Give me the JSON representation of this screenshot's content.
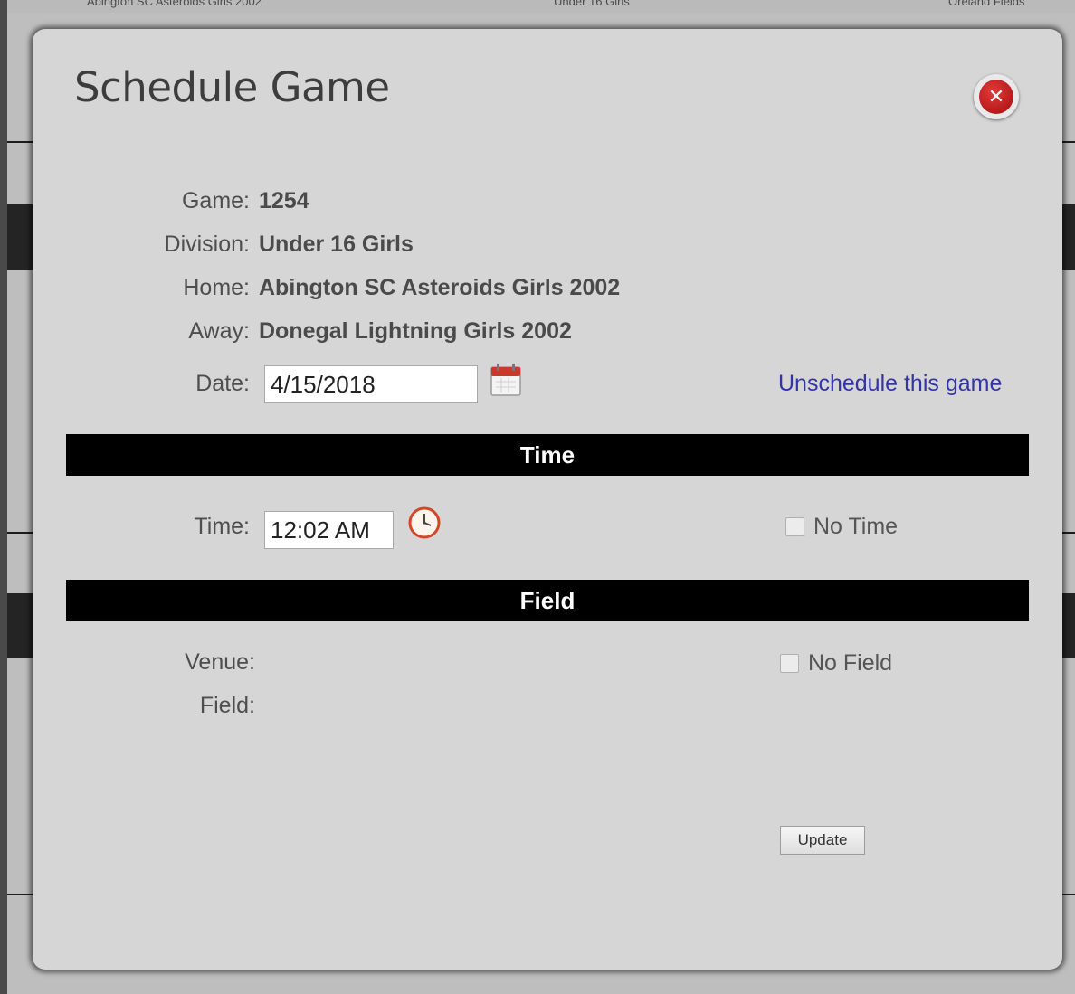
{
  "background": {
    "team": "Abington SC Asteroids Girls 2002",
    "division": "Under 16 Girls",
    "venue": "Oreland Fields"
  },
  "modal": {
    "title": "Schedule Game",
    "close_icon": "close-x-icon"
  },
  "game": {
    "label": "Game:",
    "value": "1254"
  },
  "division": {
    "label": "Division:",
    "value": "Under 16 Girls"
  },
  "home": {
    "label": "Home:",
    "value": "Abington SC Asteroids Girls 2002"
  },
  "away": {
    "label": "Away:",
    "value": "Donegal Lightning Girls 2002"
  },
  "date": {
    "label": "Date:",
    "value": "4/15/2018",
    "icon": "calendar-icon"
  },
  "unschedule_link": "Unschedule this game",
  "time_section": {
    "title": "Time",
    "label": "Time:",
    "value": "12:02 AM",
    "icon": "clock-icon",
    "no_time_label": "No Time",
    "no_time_checked": false
  },
  "field_section": {
    "title": "Field",
    "venue_label": "Venue:",
    "field_label": "Field:",
    "no_field_label": "No Field",
    "no_field_checked": false
  },
  "update_button": "Update",
  "colors": {
    "link": "#3434a6",
    "section_bar": "#000000",
    "close_button": "#c01818"
  }
}
